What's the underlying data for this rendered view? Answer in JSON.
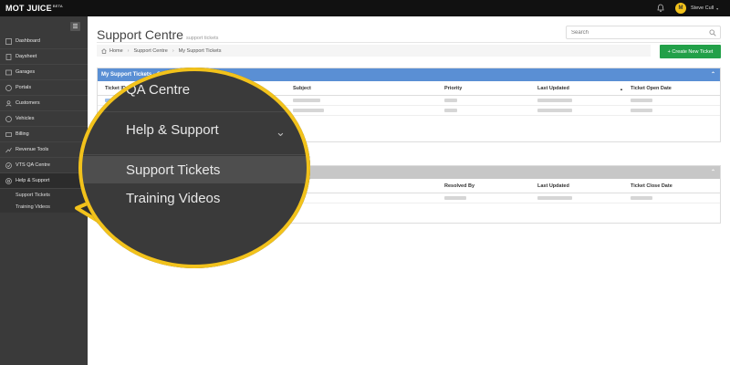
{
  "app": {
    "logo_mot": "MOT",
    "logo_juice": "JUICE",
    "logo_beta": "BETA",
    "user_initial": "M",
    "user_name": "Steve Cull"
  },
  "sidebar": {
    "items": [
      {
        "label": "Dashboard",
        "icon": "dashboard-icon"
      },
      {
        "label": "Daysheet",
        "icon": "daysheet-icon"
      },
      {
        "label": "Garages",
        "icon": "garage-icon"
      },
      {
        "label": "Portals",
        "icon": "globe-icon"
      },
      {
        "label": "Customers",
        "icon": "user-icon"
      },
      {
        "label": "Vehicles",
        "icon": "car-icon"
      },
      {
        "label": "Billing",
        "icon": "billing-icon"
      },
      {
        "label": "Revenue Tools",
        "icon": "revenue-icon",
        "chevron": "‹"
      },
      {
        "label": "VTS QA Centre",
        "icon": "check-icon",
        "chevron": "‹"
      },
      {
        "label": "Help & Support",
        "icon": "help-icon",
        "chevron": "⌄"
      }
    ],
    "subitems": [
      {
        "label": "Support Tickets"
      },
      {
        "label": "Training Videos"
      }
    ]
  },
  "main": {
    "title": "Support Centre",
    "subtitle": "support tickets",
    "search_placeholder": "Search",
    "breadcrumb": [
      "Home",
      "Support Centre",
      "My Support Tickets"
    ],
    "create_button": "+ Create New Ticket"
  },
  "panel_open": {
    "title": "My Support Tickets - OPEN",
    "columns": [
      "Ticket ID",
      "Subject",
      "Priority",
      "Last Updated",
      "Ticket Open Date"
    ],
    "sort_indicator": "▲"
  },
  "panel_closed": {
    "columns": [
      "Resolved By",
      "Last Updated",
      "Ticket Close Date"
    ]
  },
  "zoom": {
    "items": [
      "QA Centre",
      "Help & Support",
      "Support Tickets",
      "Training Videos"
    ],
    "chevron": "⌄"
  },
  "colors": {
    "accent_yellow": "#f2c21b",
    "panel_blue": "#5a8fd4",
    "create_green": "#22a049"
  }
}
